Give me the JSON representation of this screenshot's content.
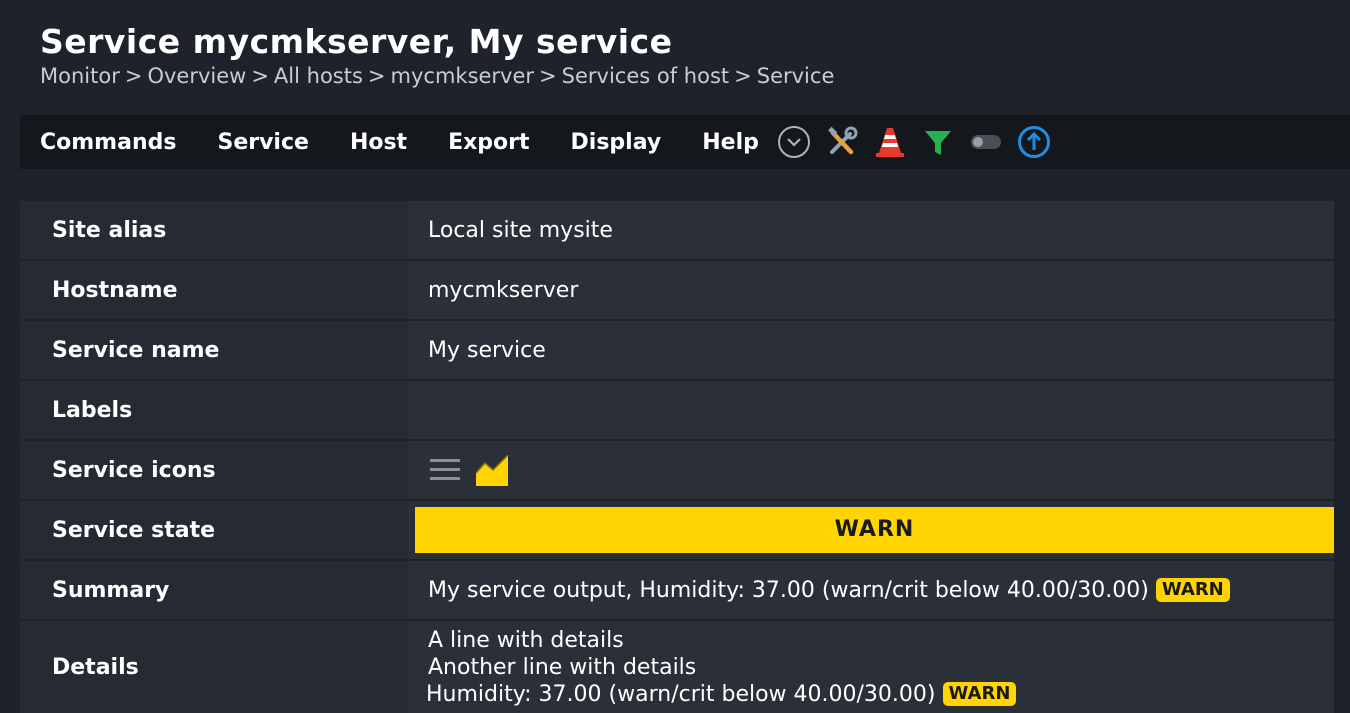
{
  "page": {
    "title": "Service mycmkserver, My service",
    "breadcrumb": [
      "Monitor",
      "Overview",
      "All hosts",
      "mycmkserver",
      "Services of host",
      "Service"
    ],
    "breadcrumb_separator": ">"
  },
  "menubar": {
    "items": [
      "Commands",
      "Service",
      "Host",
      "Export",
      "Display",
      "Help"
    ],
    "icons": [
      "chevron-down-circle-icon",
      "tools-icon",
      "traffic-cone-icon",
      "filter-icon",
      "toggle-switch-icon",
      "arrow-up-circle-icon"
    ]
  },
  "rows": {
    "site_alias": {
      "label": "Site alias",
      "value": "Local site mysite"
    },
    "hostname": {
      "label": "Hostname",
      "value": "mycmkserver"
    },
    "service_name": {
      "label": "Service name",
      "value": "My service"
    },
    "labels": {
      "label": "Labels",
      "value": ""
    },
    "service_icons": {
      "label": "Service icons",
      "icons": [
        "menu-icon",
        "graph-icon"
      ]
    },
    "service_state": {
      "label": "Service state",
      "value": "WARN"
    },
    "summary": {
      "label": "Summary",
      "text": "My service output, Humidity: 37.00 (warn/crit below 40.00/30.00)",
      "badge": "WARN"
    },
    "details": {
      "label": "Details",
      "line1": "A line with details",
      "line2": "Another line with details",
      "line3": "Humidity: 37.00 (warn/crit below 40.00/30.00)",
      "badge": "WARN"
    }
  },
  "colors": {
    "background": "#1e232b",
    "menubar": "#14171c",
    "warn": "#ffd400",
    "accent_blue": "#1e8fe6",
    "accent_green": "#27b050",
    "accent_red": "#e8372c"
  }
}
